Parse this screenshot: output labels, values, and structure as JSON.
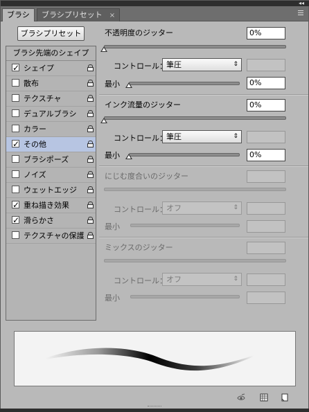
{
  "tabs": {
    "active": "ブラシ",
    "inactive": "ブラシプリセット",
    "close_glyph": "×",
    "collapse_glyph": "◂◂"
  },
  "preset_button": "ブラシプリセット",
  "list": {
    "header": "ブラシ先端のシェイプ",
    "items": [
      {
        "label": "シェイプ",
        "checked": true,
        "selected": false
      },
      {
        "label": "散布",
        "checked": false,
        "selected": false
      },
      {
        "label": "テクスチャ",
        "checked": false,
        "selected": false
      },
      {
        "label": "デュアルブラシ",
        "checked": false,
        "selected": false
      },
      {
        "label": "カラー",
        "checked": false,
        "selected": false
      },
      {
        "label": "その他",
        "checked": true,
        "selected": true
      },
      {
        "label": "ブラシポーズ",
        "checked": false,
        "selected": false
      },
      {
        "label": "ノイズ",
        "checked": false,
        "selected": false
      },
      {
        "label": "ウェットエッジ",
        "checked": false,
        "selected": false
      },
      {
        "label": "重ね描き効果",
        "checked": true,
        "selected": false
      },
      {
        "label": "滑らかさ",
        "checked": true,
        "selected": false
      },
      {
        "label": "テクスチャの保護",
        "checked": false,
        "selected": false
      }
    ]
  },
  "check_glyph": "✓",
  "arrow_glyph": "⇕",
  "opacity_jitter": {
    "title": "不透明度のジッター",
    "value": "0%",
    "control_label": "コントロール：",
    "control_value": "筆圧",
    "min_label": "最小",
    "min_value": "0%",
    "slider_level": 0,
    "min_slider_level": 0
  },
  "flow_jitter": {
    "title": "インク流量のジッター",
    "value": "0%",
    "control_label": "コントロール：",
    "control_value": "筆圧",
    "min_label": "最小",
    "min_value": "0%",
    "slider_level": 0,
    "min_slider_level": 0
  },
  "wetness_jitter": {
    "title": "にじむ度合いのジッター",
    "control_label": "コントロール：",
    "control_value": "オフ",
    "min_label": "最小"
  },
  "mix_jitter": {
    "title": "ミックスのジッター",
    "control_label": "コントロール：",
    "control_value": "オフ",
    "min_label": "最小"
  },
  "status_icons": [
    "brush-eye-icon",
    "grid-icon",
    "new-preset-icon"
  ]
}
